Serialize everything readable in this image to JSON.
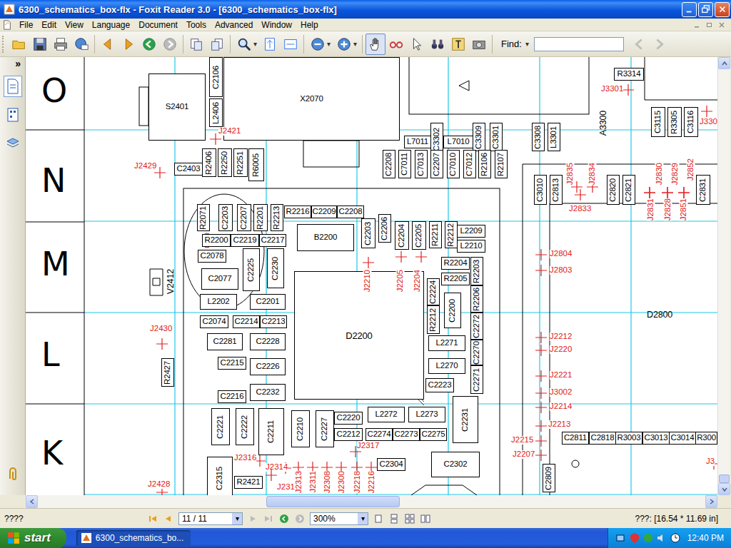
{
  "window": {
    "title": "6300_schematics_box-flx - Foxit Reader 3.0 - [6300_schematics_box-flx]"
  },
  "menu": [
    "File",
    "Edit",
    "View",
    "Language",
    "Document",
    "Tools",
    "Advanced",
    "Window",
    "Help"
  ],
  "toolbar": {
    "find_label": "Find:"
  },
  "sidebar": {
    "toggle": "»"
  },
  "document": {
    "row_letters": [
      "O",
      "N",
      "M",
      "L",
      "K"
    ],
    "components": [
      {
        "label": "S2401",
        "kind": "part"
      },
      {
        "label": "C2106",
        "kind": "part"
      },
      {
        "label": "L2406",
        "kind": "part"
      },
      {
        "label": "X2070",
        "kind": "part"
      },
      {
        "label": "R2406",
        "kind": "part"
      },
      {
        "label": "R2250",
        "kind": "part"
      },
      {
        "label": "R2251",
        "kind": "part"
      },
      {
        "label": "R6005",
        "kind": "part"
      },
      {
        "label": "C2403",
        "kind": "part"
      },
      {
        "label": "L7011",
        "kind": "part"
      },
      {
        "label": "L7010",
        "kind": "part"
      },
      {
        "label": "C3302",
        "kind": "part"
      },
      {
        "label": "C3309",
        "kind": "part"
      },
      {
        "label": "C3301",
        "kind": "part"
      },
      {
        "label": "C3308",
        "kind": "part"
      },
      {
        "label": "L3301",
        "kind": "part"
      },
      {
        "label": "C2208",
        "kind": "part"
      },
      {
        "label": "C7011",
        "kind": "part"
      },
      {
        "label": "C7013",
        "kind": "part"
      },
      {
        "label": "C2207",
        "kind": "part"
      },
      {
        "label": "C7010",
        "kind": "part"
      },
      {
        "label": "C7012",
        "kind": "part"
      },
      {
        "label": "R2106",
        "kind": "part"
      },
      {
        "label": "R2107",
        "kind": "part"
      },
      {
        "label": "R3314",
        "kind": "part"
      },
      {
        "label": "C3115",
        "kind": "part"
      },
      {
        "label": "R3305",
        "kind": "part"
      },
      {
        "label": "C3116",
        "kind": "part"
      },
      {
        "label": "A3300",
        "kind": "label"
      },
      {
        "label": "C3010",
        "kind": "part"
      },
      {
        "label": "C2813",
        "kind": "part"
      },
      {
        "label": "C2820",
        "kind": "part"
      },
      {
        "label": "C2821",
        "kind": "part"
      },
      {
        "label": "C2831",
        "kind": "part"
      },
      {
        "label": "D2800",
        "kind": "label"
      },
      {
        "label": "B2200",
        "kind": "part"
      },
      {
        "label": "D2200",
        "kind": "chip"
      },
      {
        "label": "R2071",
        "kind": "part"
      },
      {
        "label": "C2203",
        "kind": "part"
      },
      {
        "label": "C2207",
        "kind": "part"
      },
      {
        "label": "R2201",
        "kind": "part"
      },
      {
        "label": "R2213",
        "kind": "part"
      },
      {
        "label": "R2216",
        "kind": "part"
      },
      {
        "label": "C2209",
        "kind": "part"
      },
      {
        "label": "C2208",
        "kind": "part"
      },
      {
        "label": "C2203",
        "kind": "part"
      },
      {
        "label": "C2206",
        "kind": "part"
      },
      {
        "label": "C2204",
        "kind": "part"
      },
      {
        "label": "C2205",
        "kind": "part"
      },
      {
        "label": "R2211",
        "kind": "part"
      },
      {
        "label": "R2212",
        "kind": "part"
      },
      {
        "label": "L2209",
        "kind": "part"
      },
      {
        "label": "L2210",
        "kind": "part"
      },
      {
        "label": "R2200",
        "kind": "part"
      },
      {
        "label": "C2219",
        "kind": "part"
      },
      {
        "label": "C2217",
        "kind": "part"
      },
      {
        "label": "C2078",
        "kind": "part"
      },
      {
        "label": "C2077",
        "kind": "part"
      },
      {
        "label": "C2225",
        "kind": "part"
      },
      {
        "label": "C2230",
        "kind": "part"
      },
      {
        "label": "R2204",
        "kind": "part"
      },
      {
        "label": "R2205",
        "kind": "part"
      },
      {
        "label": "R2203",
        "kind": "part"
      },
      {
        "label": "R2206",
        "kind": "part"
      },
      {
        "label": "C2224",
        "kind": "part"
      },
      {
        "label": "R2212",
        "kind": "part"
      },
      {
        "label": "C2200",
        "kind": "part"
      },
      {
        "label": "C2272",
        "kind": "part"
      },
      {
        "label": "L2271",
        "kind": "part"
      },
      {
        "label": "C2270",
        "kind": "part"
      },
      {
        "label": "L2270",
        "kind": "part"
      },
      {
        "label": "C2271",
        "kind": "part"
      },
      {
        "label": "C2223",
        "kind": "part"
      },
      {
        "label": "L2202",
        "kind": "part"
      },
      {
        "label": "C2201",
        "kind": "part"
      },
      {
        "label": "C2074",
        "kind": "part"
      },
      {
        "label": "C2214",
        "kind": "part"
      },
      {
        "label": "C2213",
        "kind": "part"
      },
      {
        "label": "C2281",
        "kind": "part"
      },
      {
        "label": "C2228",
        "kind": "part"
      },
      {
        "label": "C2215",
        "kind": "part"
      },
      {
        "label": "C2226",
        "kind": "part"
      },
      {
        "label": "C2216",
        "kind": "part"
      },
      {
        "label": "C2232",
        "kind": "part"
      },
      {
        "label": "C2221",
        "kind": "part"
      },
      {
        "label": "C2222",
        "kind": "part"
      },
      {
        "label": "C2211",
        "kind": "part"
      },
      {
        "label": "C2210",
        "kind": "part"
      },
      {
        "label": "C2227",
        "kind": "part"
      },
      {
        "label": "C2220",
        "kind": "part"
      },
      {
        "label": "C2212",
        "kind": "part"
      },
      {
        "label": "L2272",
        "kind": "part"
      },
      {
        "label": "L2273",
        "kind": "part"
      },
      {
        "label": "C2274",
        "kind": "part"
      },
      {
        "label": "C2273",
        "kind": "part"
      },
      {
        "label": "C2275",
        "kind": "part"
      },
      {
        "label": "C2231",
        "kind": "part"
      },
      {
        "label": "C2304",
        "kind": "part"
      },
      {
        "label": "C2302",
        "kind": "part"
      },
      {
        "label": "C2315",
        "kind": "part"
      },
      {
        "label": "R2421",
        "kind": "part"
      },
      {
        "label": "R2427",
        "kind": "part"
      },
      {
        "label": "V2412",
        "kind": "label"
      },
      {
        "label": "C2811",
        "kind": "part"
      },
      {
        "label": "C2818",
        "kind": "part"
      },
      {
        "label": "R3003",
        "kind": "part"
      },
      {
        "label": "C3013",
        "kind": "part"
      },
      {
        "label": "C3014",
        "kind": "part"
      },
      {
        "label": "R300",
        "kind": "part"
      },
      {
        "label": "C2809",
        "kind": "part"
      }
    ],
    "test_points": [
      {
        "label": "J2421"
      },
      {
        "label": "J2429"
      },
      {
        "label": "J2430"
      },
      {
        "label": "J2428"
      },
      {
        "label": "J2316"
      },
      {
        "label": "J2314"
      },
      {
        "label": "J2312"
      },
      {
        "label": "J2313"
      },
      {
        "label": "J2311"
      },
      {
        "label": "J2308"
      },
      {
        "label": "J2300"
      },
      {
        "label": "J2218"
      },
      {
        "label": "J2216"
      },
      {
        "label": "J2317"
      },
      {
        "label": "J2210"
      },
      {
        "label": "J2205"
      },
      {
        "label": "J2204"
      },
      {
        "label": "J2804"
      },
      {
        "label": "J2803"
      },
      {
        "label": "J2212"
      },
      {
        "label": "J2220"
      },
      {
        "label": "J2221"
      },
      {
        "label": "J3002"
      },
      {
        "label": "J2214"
      },
      {
        "label": "J2213"
      },
      {
        "label": "J2215"
      },
      {
        "label": "J2207"
      },
      {
        "label": "J3"
      },
      {
        "label": "J3301"
      },
      {
        "label": "J330"
      },
      {
        "label": "J2835"
      },
      {
        "label": "J2834"
      },
      {
        "label": "J2833"
      },
      {
        "label": "J2830"
      },
      {
        "label": "J2829"
      },
      {
        "label": "J2852"
      },
      {
        "label": "J2831"
      },
      {
        "label": "J2828"
      },
      {
        "label": "J2851"
      }
    ]
  },
  "status_bar": {
    "left": "????",
    "page": "11 / 11",
    "zoom": "300%",
    "coords": "???: [16.54 * 11.69 in]"
  },
  "taskbar": {
    "start": "start",
    "tasks": [
      {
        "label": "6300_schematics_bo...",
        "selected": true
      }
    ],
    "clock": "12:40 PM"
  }
}
